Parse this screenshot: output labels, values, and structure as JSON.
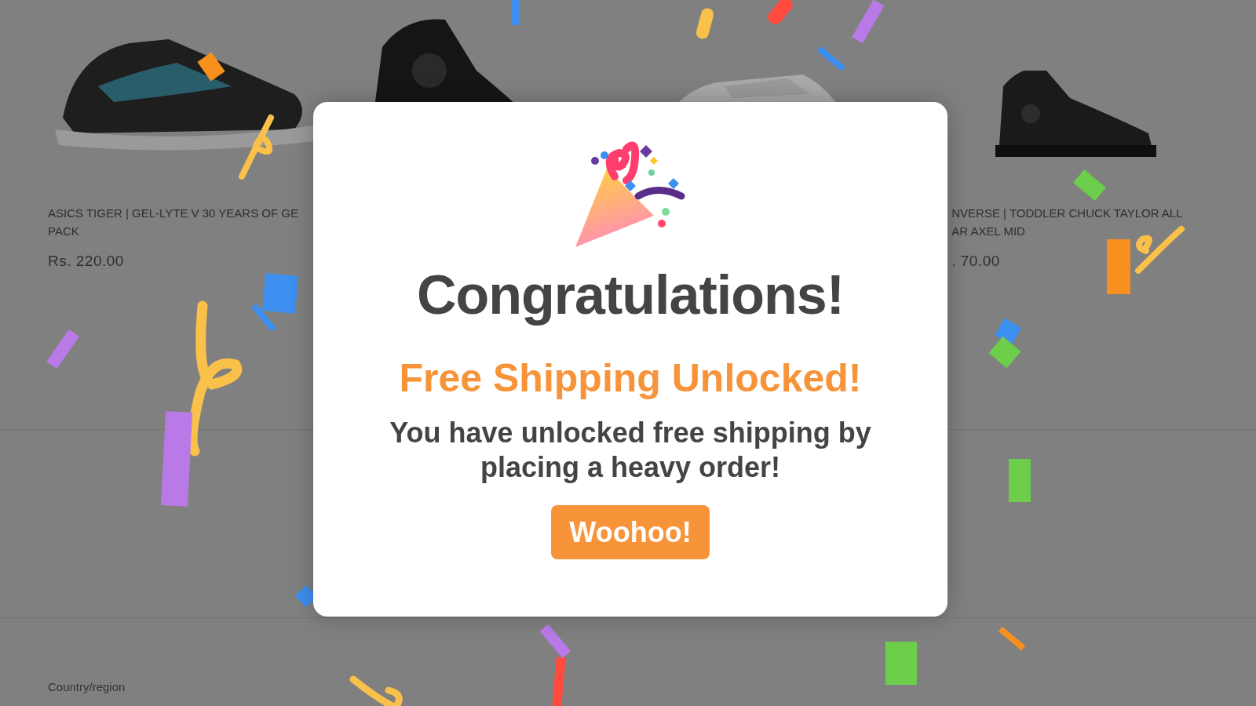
{
  "products": [
    {
      "kind": "picture",
      "lines": [
        "ASICS TIGER | GEL-LYTE V 30 YEARS OF GE",
        "PACK"
      ],
      "price": "Rs. 220.00"
    },
    {
      "kind": "picture"
    },
    {
      "kind": "picture"
    },
    {
      "kind": "picture",
      "lines": [
        "NVERSE | TODDLER CHUCK TAYLOR ALL",
        "AR AXEL MID"
      ],
      "price": ". 70.00"
    }
  ],
  "footer": {
    "label": "Country/region"
  },
  "modal": {
    "title": "Congratulations!",
    "subtitle": "Free Shipping Unlocked!",
    "message": "You have unlocked free shipping by placing a heavy order!",
    "button": "Woohoo!"
  }
}
